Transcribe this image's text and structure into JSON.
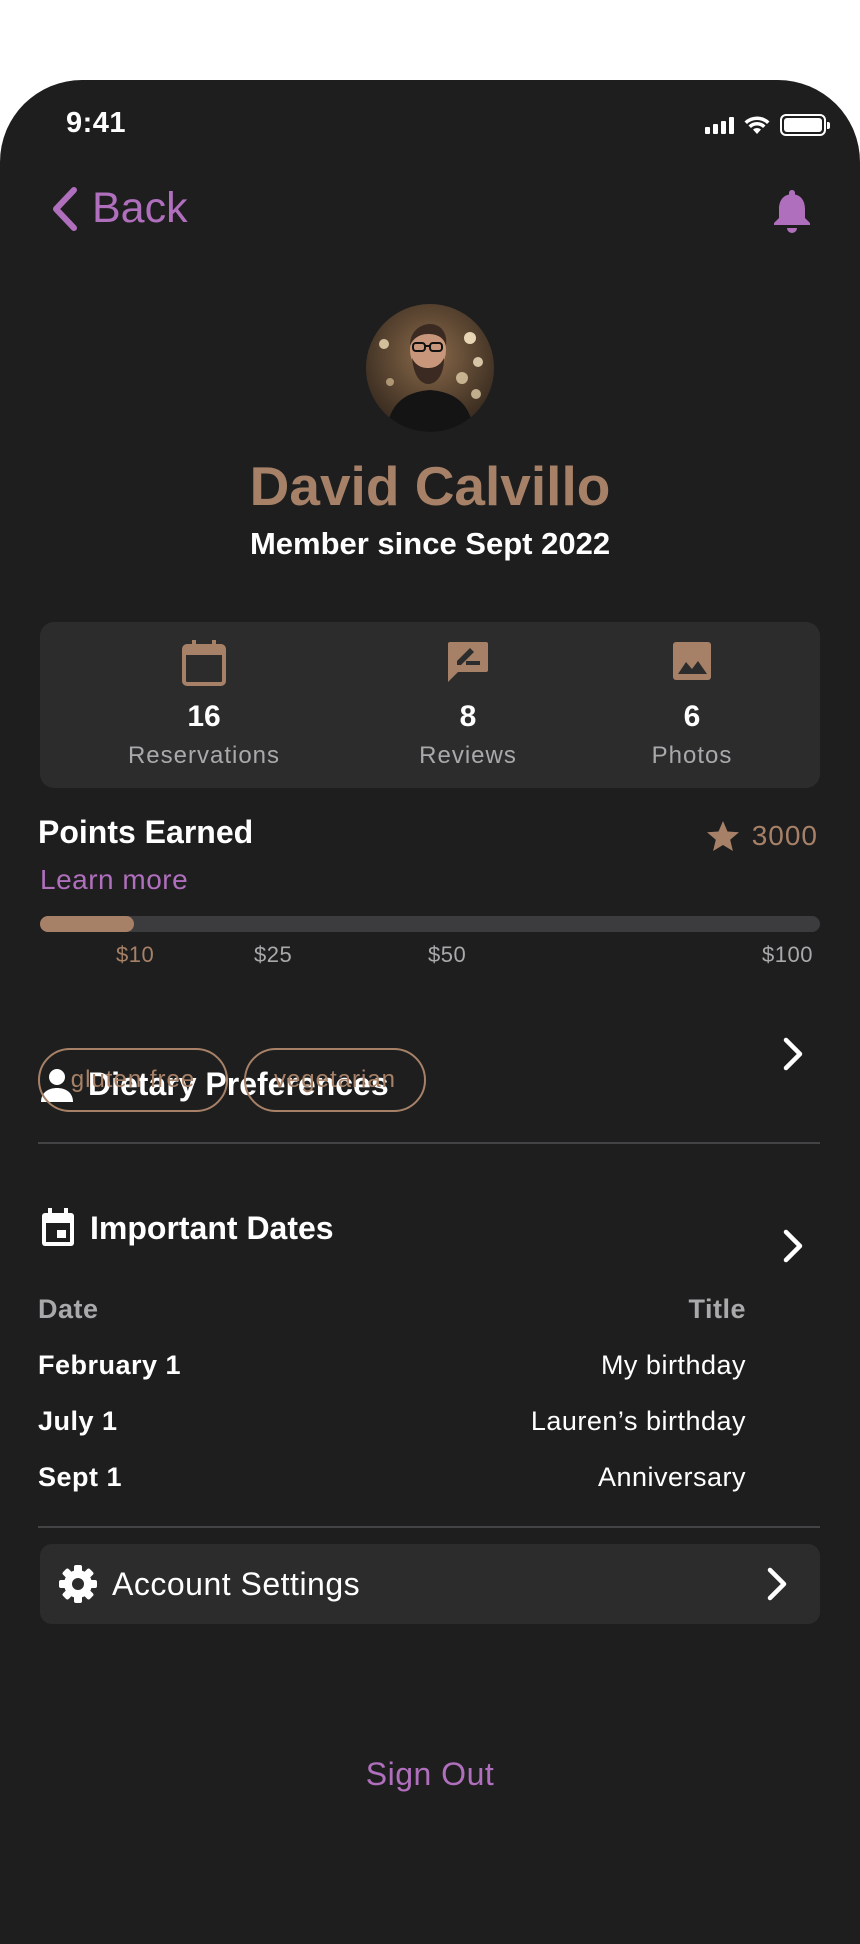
{
  "status_bar": {
    "time": "9:41"
  },
  "nav": {
    "back_label": "Back"
  },
  "profile": {
    "name": "David Calvillo",
    "member_since": "Member since Sept 2022"
  },
  "stats": [
    {
      "icon": "calendar-icon",
      "value": "16",
      "label": "Reservations"
    },
    {
      "icon": "review-icon",
      "value": "8",
      "label": "Reviews"
    },
    {
      "icon": "photo-icon",
      "value": "6",
      "label": "Photos"
    }
  ],
  "points": {
    "title": "Points Earned",
    "learn_more": "Learn more",
    "value": "3000",
    "progress_fraction": 0.12,
    "ticks": [
      "$10",
      "$25",
      "$50",
      "$100"
    ]
  },
  "dietary": {
    "title": "Dietary Preferences",
    "chips": [
      "gluten free",
      "vegetarian"
    ]
  },
  "dates": {
    "title": "Important Dates",
    "columns": [
      "Date",
      "Title"
    ],
    "rows": [
      {
        "date": "February 1",
        "title": "My birthday"
      },
      {
        "date": "July 1",
        "title": "Lauren’s birthday"
      },
      {
        "date": "Sept 1",
        "title": "Anniversary"
      }
    ]
  },
  "settings": {
    "label": "Account Settings"
  },
  "sign_out": "Sign Out",
  "colors": {
    "background": "#1e1e1f",
    "card": "#2c2c2d",
    "accent_purple": "#b06fbd",
    "accent_tan": "#a78167"
  }
}
